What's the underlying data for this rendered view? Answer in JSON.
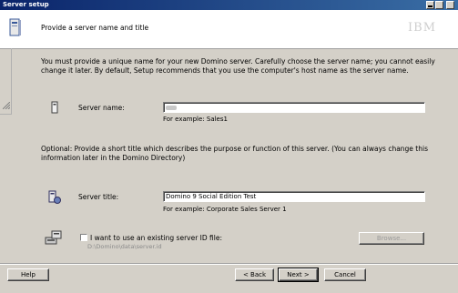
{
  "window": {
    "title": "Server setup"
  },
  "header": {
    "instruction": "Provide a server name and title",
    "brand": "IBM"
  },
  "intro_text": "You must provide a unique name for your new Domino server. Carefully choose the server name; you cannot easily change it later. By default, Setup recommends that you use the computer's host name as the server name.",
  "server_name": {
    "label": "Server name:",
    "value": "",
    "example": "For example: Sales1"
  },
  "optional_text": "Optional: Provide a short title which describes the purpose or function of this server. (You can always change this information later in the Domino Directory)",
  "server_title": {
    "label": "Server title:",
    "value": "Domino 9 Social Edition Test",
    "example": "For example: Corporate Sales Server 1"
  },
  "server_id": {
    "checkbox_label": "I want to use an existing server ID file:",
    "checked": false,
    "path": "D:\\Domino\\data\\server.id",
    "browse_label": "Browse..."
  },
  "buttons": {
    "help": "Help",
    "back": "< Back",
    "next": "Next >",
    "cancel": "Cancel"
  }
}
